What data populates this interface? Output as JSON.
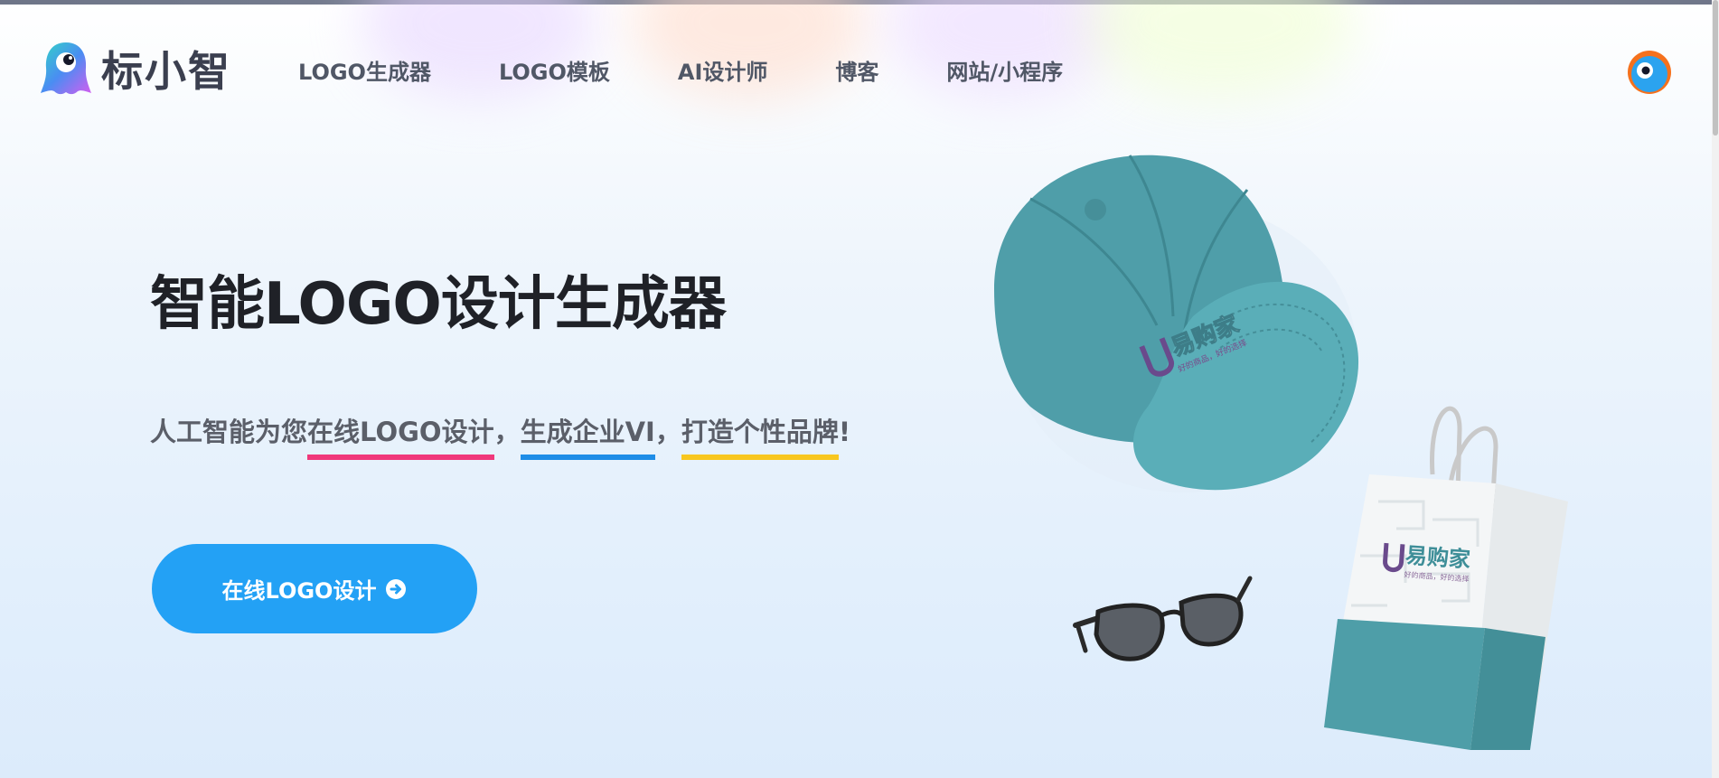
{
  "brand": {
    "name": "标小智"
  },
  "nav": {
    "items": [
      {
        "label": "LOGO生成器"
      },
      {
        "label": "LOGO模板"
      },
      {
        "label": "AI设计师"
      },
      {
        "label": "博客"
      },
      {
        "label": "网站/小程序"
      }
    ]
  },
  "hero": {
    "title": "智能LOGO设计生成器",
    "subtitle": {
      "prefix": "人工智能为您",
      "part1": "在线LOGO设计",
      "sep1": "，",
      "part2": "生成企业VI",
      "sep2": "，",
      "part3": "打造个性品牌",
      "suffix": "!"
    },
    "cta_label": "在线LOGO设计"
  },
  "mockups": {
    "brand_name": "易购家",
    "tagline": "好的商品，好的选择"
  },
  "colors": {
    "accent": "#23a1f5",
    "underline_pink": "#f0387b",
    "underline_blue": "#1e8de7",
    "underline_yellow": "#f8c71f",
    "product_teal": "#4e9da8"
  }
}
